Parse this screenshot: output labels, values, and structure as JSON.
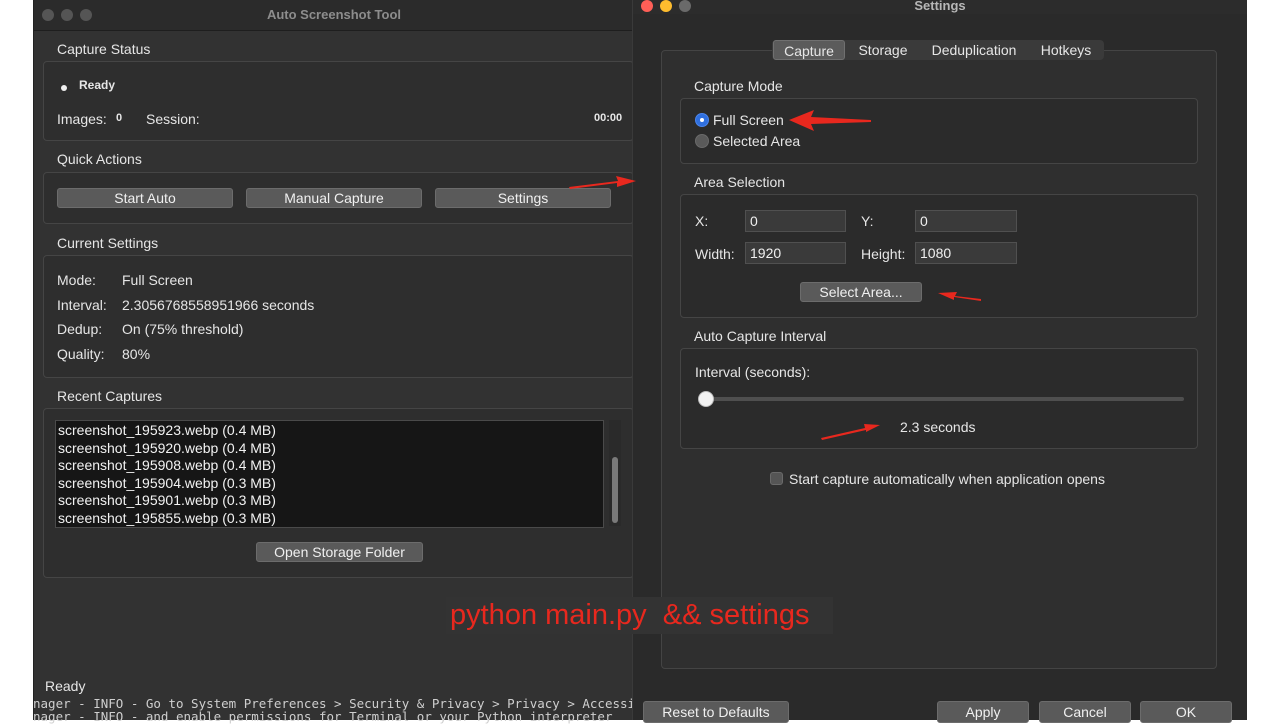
{
  "main_window": {
    "title": "Auto Screenshot Tool",
    "capture_status": {
      "heading": "Capture Status",
      "status": "Ready",
      "images_label": "Images:",
      "images_value": "0",
      "session_label": "Session:",
      "session_value": "00:00"
    },
    "quick_actions": {
      "heading": "Quick Actions",
      "start_auto": "Start Auto",
      "manual_capture": "Manual Capture",
      "settings": "Settings"
    },
    "current_settings": {
      "heading": "Current Settings",
      "rows": [
        {
          "label": "Mode:",
          "value": "Full Screen"
        },
        {
          "label": "Interval:",
          "value": "2.3056768558951966 seconds"
        },
        {
          "label": "Dedup:",
          "value": "On (75% threshold)"
        },
        {
          "label": "Quality:",
          "value": "80%"
        }
      ]
    },
    "recent_captures": {
      "heading": "Recent Captures",
      "items": [
        "screenshot_195923.webp (0.4 MB)",
        "screenshot_195920.webp (0.4 MB)",
        "screenshot_195908.webp (0.4 MB)",
        "screenshot_195904.webp (0.3 MB)",
        "screenshot_195901.webp (0.3 MB)",
        "screenshot_195855.webp (0.3 MB)"
      ],
      "open_folder": "Open Storage Folder"
    },
    "status_bar": "Ready"
  },
  "terminal": {
    "line1": "nager - INFO - Go to System Preferences > Security & Privacy > Privacy > Accessibil",
    "line2": "nager - INFO - and enable permissions for Terminal or your Python interpreter"
  },
  "settings_window": {
    "title": "Settings",
    "tabs": [
      "Capture",
      "Storage",
      "Deduplication",
      "Hotkeys"
    ],
    "active_tab": "Capture",
    "capture_mode": {
      "heading": "Capture Mode",
      "options": [
        "Full Screen",
        "Selected Area"
      ],
      "selected": "Full Screen"
    },
    "area_selection": {
      "heading": "Area Selection",
      "x_label": "X:",
      "x_value": "0",
      "y_label": "Y:",
      "y_value": "0",
      "width_label": "Width:",
      "width_value": "1920",
      "height_label": "Height:",
      "height_value": "1080",
      "select_area_button": "Select Area..."
    },
    "auto_capture_interval": {
      "heading": "Auto Capture Interval",
      "interval_label": "Interval (seconds):",
      "interval_value_text": "2.3 seconds",
      "slider_fraction": 0.0
    },
    "auto_start_checkbox": {
      "label": "Start capture automatically when application opens",
      "checked": false
    },
    "buttons": {
      "reset": "Reset to Defaults",
      "apply": "Apply",
      "cancel": "Cancel",
      "ok": "OK"
    }
  },
  "overlay_caption": "python main.py  && settings",
  "colors": {
    "annotation_red": "#e8281e",
    "radio_selected": "#2f6fde",
    "caption_bg": "#333333"
  }
}
